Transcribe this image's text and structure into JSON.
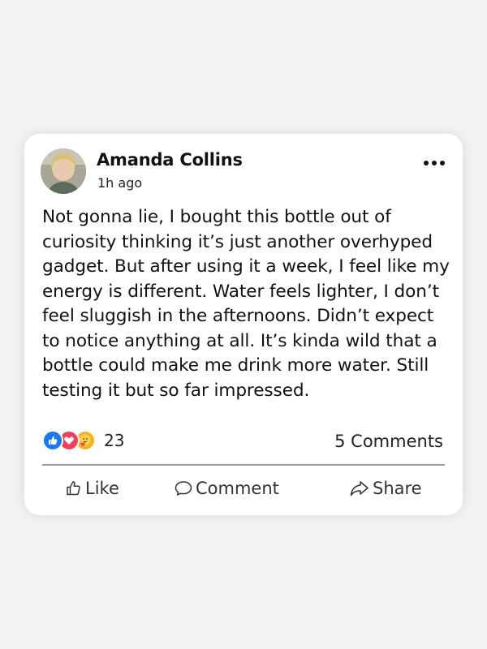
{
  "post": {
    "author": "Amanda Collins",
    "time": "1h ago",
    "text": "Not gonna lie, I bought this bottle out of curiosity thinking it’s just another overhyped gadget. But after using it a week, I feel like my energy is different. Water feels lighter, I don’t feel sluggish in the afternoons. Didn’t expect to notice anything at all. It’s kinda wild that a bottle could make me drink more water. Still testing it but so far impressed."
  },
  "reactions": {
    "icons": [
      "like-icon",
      "love-icon",
      "care-icon"
    ],
    "count": "23"
  },
  "comments_label": "5 Comments",
  "actions": {
    "like": "Like",
    "comment": "Comment",
    "share": "Share"
  },
  "colors": {
    "like_blue": "#1877f2",
    "love_red": "#f33e58",
    "care_yellow": "#f7b125"
  }
}
